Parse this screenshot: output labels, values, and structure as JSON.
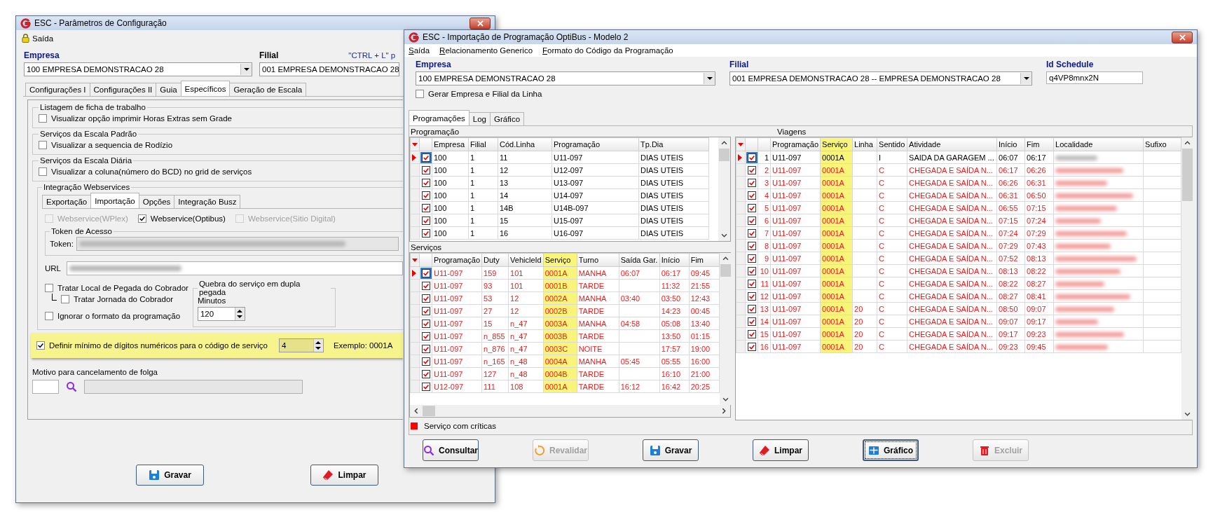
{
  "config_window": {
    "title": "ESC - Parâmetros de Configuração",
    "menu": [
      {
        "label": "Saída"
      }
    ],
    "hint": "\"CTRL + L\" p",
    "empresa": {
      "label": "Empresa",
      "value": "100 EMPRESA DEMONSTRACAO 28"
    },
    "filial": {
      "label": "Filial",
      "value": "001 EMPRESA DEMONSTRACAO 28"
    },
    "tabs": [
      {
        "label": "Configurações I",
        "selected": false
      },
      {
        "label": "Configurações II",
        "selected": false
      },
      {
        "label": "Guia",
        "selected": false
      },
      {
        "label": "Específicos",
        "selected": true
      },
      {
        "label": "Geração de Escala",
        "selected": false
      }
    ],
    "sections": [
      {
        "title": "Listagem de ficha de trabalho",
        "options": [
          {
            "label": "Visualizar opção imprimir Horas Extras sem Grade",
            "checked": false
          }
        ]
      },
      {
        "title": "Serviços da Escala Padrão",
        "options": [
          {
            "label": "Visualizar a sequencia de Rodízio",
            "checked": false
          }
        ]
      },
      {
        "title": "Serviços da Escala Diária",
        "options": [
          {
            "label": "Visualizar a coluna(número do BCD) no grid de serviços",
            "checked": false
          }
        ]
      }
    ],
    "integration": {
      "title": "Integração Webservices",
      "tabs": [
        {
          "label": "Exportação",
          "selected": false
        },
        {
          "label": "Importação",
          "selected": true
        },
        {
          "label": "Opções",
          "selected": false
        },
        {
          "label": "Integração Busz",
          "selected": false
        }
      ],
      "services": [
        {
          "label": "Webservice(WPlex)",
          "checked": false,
          "disabled": true
        },
        {
          "label": "Webservice(Optibus)",
          "checked": true,
          "disabled": false
        },
        {
          "label": "Webservice(Sitio Digital)",
          "checked": false,
          "disabled": true
        }
      ],
      "token_group": "Token de Acesso",
      "token_label": "Token:",
      "url_label": "URL"
    },
    "options": [
      {
        "label": "Tratar Local de Pegada do Cobrador",
        "checked": false,
        "children": [
          {
            "label": "Tratar  Jornada do Cobrador",
            "checked": false
          }
        ]
      },
      {
        "label": "Ignorar o formato da programação",
        "checked": false
      }
    ],
    "split": {
      "title": "Quebra do serviço em dupla pegada",
      "label": "Minutos",
      "value": "120"
    },
    "digits": {
      "label": "Definir mínimo de dígitos numéricos para o código de serviço",
      "checked": true,
      "value": "4",
      "example": "Exemplo: 0001A",
      "highlighted": true
    },
    "motivo": {
      "label": "Motivo para cancelamento de folga"
    },
    "buttons": [
      {
        "label": "Gravar",
        "kind": "save",
        "disabled": false
      },
      {
        "label": "Limpar",
        "kind": "clear",
        "disabled": false
      }
    ]
  },
  "import_window": {
    "title": "ESC - Importação de Programação OptiBus - Modelo 2",
    "menu": [
      {
        "label": "Saída"
      },
      {
        "label": "Relacionamento Generico"
      },
      {
        "label": "Formato do Código da Programação"
      }
    ],
    "empresa": {
      "label": "Empresa",
      "value": "100 EMPRESA DEMONSTRACAO 28"
    },
    "filial": {
      "label": "Filial",
      "value": "001 EMPRESA DEMONSTRACAO 28 -- EMPRESA DEMONSTRACAO 28"
    },
    "schedule": {
      "label": "Id Schedule",
      "value": "q4VP8mnx2N"
    },
    "gerar": {
      "label": "Gerar Empresa e Filial da Linha",
      "checked": false
    },
    "tabs": [
      {
        "label": "Programações",
        "selected": true
      },
      {
        "label": "Log",
        "selected": false
      },
      {
        "label": "Gráfico",
        "selected": false
      }
    ],
    "programacao": {
      "title": "Programação",
      "columns": [
        {
          "label": "Empresa",
          "highlighted": false
        },
        {
          "label": "Filial",
          "highlighted": false
        },
        {
          "label": "Cód.Linha",
          "highlighted": false
        },
        {
          "label": "Programação",
          "highlighted": false
        },
        {
          "label": "Tp.Dia",
          "highlighted": false
        }
      ],
      "rows": [
        {
          "selected": true,
          "checked": true,
          "empresa": "100",
          "filial": "1",
          "cod_linha": "11",
          "programacao": "U11-097",
          "tp_dia": "DIAS UTEIS"
        },
        {
          "selected": false,
          "checked": true,
          "empresa": "100",
          "filial": "1",
          "cod_linha": "12",
          "programacao": "U12-097",
          "tp_dia": "DIAS UTEIS"
        },
        {
          "selected": false,
          "checked": true,
          "empresa": "100",
          "filial": "1",
          "cod_linha": "13",
          "programacao": "U13-097",
          "tp_dia": "DIAS UTEIS"
        },
        {
          "selected": false,
          "checked": true,
          "empresa": "100",
          "filial": "1",
          "cod_linha": "14",
          "programacao": "U14-097",
          "tp_dia": "DIAS UTEIS"
        },
        {
          "selected": false,
          "checked": true,
          "empresa": "100",
          "filial": "1",
          "cod_linha": "14B",
          "programacao": "U14B-097",
          "tp_dia": "DIAS UTEIS"
        },
        {
          "selected": false,
          "checked": true,
          "empresa": "100",
          "filial": "1",
          "cod_linha": "15",
          "programacao": "U15-097",
          "tp_dia": "DIAS UTEIS"
        },
        {
          "selected": false,
          "checked": true,
          "empresa": "100",
          "filial": "1",
          "cod_linha": "16",
          "programacao": "U16-097",
          "tp_dia": "DIAS UTEIS"
        }
      ]
    },
    "servicos": {
      "title": "Serviços",
      "columns": [
        {
          "label": "Programação",
          "highlighted": false
        },
        {
          "label": "Duty",
          "highlighted": false
        },
        {
          "label": "VehicleId",
          "highlighted": false
        },
        {
          "label": "Serviço",
          "highlighted": true
        },
        {
          "label": "Turno",
          "highlighted": false
        },
        {
          "label": "Saída Gar.",
          "highlighted": false
        },
        {
          "label": "Início",
          "highlighted": false
        },
        {
          "label": "Fim",
          "highlighted": false
        }
      ],
      "rows": [
        {
          "selected": true,
          "checked": true,
          "critical": true,
          "programacao": "U11-097",
          "duty": "159",
          "vehicle_id": "101",
          "servico": "0001A",
          "turno": "MANHA",
          "saida_gar": "06:07",
          "inicio": "06:17",
          "fim": "09:45"
        },
        {
          "selected": false,
          "checked": true,
          "critical": true,
          "programacao": "U11-097",
          "duty": "93",
          "vehicle_id": "101",
          "servico": "0001B",
          "turno": "TARDE",
          "inicio": "11:32",
          "fim": "21:55"
        },
        {
          "selected": false,
          "checked": true,
          "critical": true,
          "programacao": "U11-097",
          "duty": "53",
          "vehicle_id": "12",
          "servico": "0002A",
          "turno": "MANHA",
          "saida_gar": "03:40",
          "inicio": "03:50",
          "fim": "12:43"
        },
        {
          "selected": false,
          "checked": true,
          "critical": true,
          "programacao": "U11-097",
          "duty": "27",
          "vehicle_id": "12",
          "servico": "0002B",
          "turno": "TARDE",
          "inicio": "14:23",
          "fim": "00:45"
        },
        {
          "selected": false,
          "checked": true,
          "critical": true,
          "programacao": "U11-097",
          "duty": "15",
          "vehicle_id": "n_47",
          "servico": "0003A",
          "turno": "MANHA",
          "saida_gar": "04:58",
          "inicio": "05:08",
          "fim": "13:40"
        },
        {
          "selected": false,
          "checked": true,
          "critical": true,
          "programacao": "U11-097",
          "duty": "n_855",
          "vehicle_id": "n_47",
          "servico": "0003B",
          "turno": "TARDE",
          "inicio": "13:50",
          "fim": "01:15"
        },
        {
          "selected": false,
          "checked": true,
          "critical": true,
          "programacao": "U11-097",
          "duty": "n_876",
          "vehicle_id": "n_47",
          "servico": "0003C",
          "turno": "NOITE",
          "inicio": "17:57",
          "fim": "19:00"
        },
        {
          "selected": false,
          "checked": true,
          "critical": true,
          "programacao": "U11-097",
          "duty": "n_165",
          "vehicle_id": "n_48",
          "servico": "0004A",
          "turno": "MANHA",
          "saida_gar": "05:45",
          "inicio": "05:55",
          "fim": "16:00"
        },
        {
          "selected": false,
          "checked": true,
          "critical": true,
          "programacao": "U11-097",
          "duty": "127",
          "vehicle_id": "n_48",
          "servico": "0004B",
          "turno": "TARDE",
          "inicio": "16:10",
          "fim": "21:00"
        },
        {
          "selected": false,
          "checked": true,
          "critical": true,
          "programacao": "U12-097",
          "duty": "111",
          "vehicle_id": "108",
          "servico": "0001A",
          "turno": "TARDE",
          "saida_gar": "16:12",
          "inicio": "16:42",
          "fim": "20:25"
        }
      ]
    },
    "viagens": {
      "title": "Viagens",
      "columns": [
        {
          "label": "Programação",
          "highlighted": false
        },
        {
          "label": "Serviço",
          "highlighted": true
        },
        {
          "label": "Linha",
          "highlighted": false
        },
        {
          "label": "Sentido",
          "highlighted": false
        },
        {
          "label": "Atividade",
          "highlighted": false
        },
        {
          "label": "Início",
          "highlighted": false
        },
        {
          "label": "Fim",
          "highlighted": false
        },
        {
          "label": "Localidade",
          "highlighted": false
        },
        {
          "label": "Sufixo",
          "highlighted": false
        }
      ],
      "rows": [
        {
          "selected": true,
          "checked": true,
          "critical": false,
          "num": "1",
          "programacao": "U11-097",
          "servico": "0001A",
          "sentido": "I",
          "atividade": "SAIDA DA GARAGEM ...",
          "inicio": "06:07",
          "fim": "06:17"
        },
        {
          "selected": false,
          "checked": true,
          "critical": true,
          "num": "2",
          "programacao": "U11-097",
          "servico": "0001A",
          "sentido": "C",
          "atividade": "CHEGADA E SAÍDA N...",
          "inicio": "06:17",
          "fim": "06:26"
        },
        {
          "selected": false,
          "checked": true,
          "critical": true,
          "num": "3",
          "programacao": "U11-097",
          "servico": "0001A",
          "sentido": "C",
          "atividade": "CHEGADA E SAÍDA N...",
          "inicio": "06:26",
          "fim": "06:31"
        },
        {
          "selected": false,
          "checked": true,
          "critical": true,
          "num": "4",
          "programacao": "U11-097",
          "servico": "0001A",
          "sentido": "C",
          "atividade": "CHEGADA E SAÍDA N...",
          "inicio": "06:31",
          "fim": "06:50"
        },
        {
          "selected": false,
          "checked": true,
          "critical": true,
          "num": "5",
          "programacao": "U11-097",
          "servico": "0001A",
          "sentido": "C",
          "atividade": "CHEGADA E SAÍDA N...",
          "inicio": "06:55",
          "fim": "07:15"
        },
        {
          "selected": false,
          "checked": true,
          "critical": true,
          "num": "6",
          "programacao": "U11-097",
          "servico": "0001A",
          "sentido": "C",
          "atividade": "CHEGADA E SAÍDA N...",
          "inicio": "07:15",
          "fim": "07:24"
        },
        {
          "selected": false,
          "checked": true,
          "critical": true,
          "num": "7",
          "programacao": "U11-097",
          "servico": "0001A",
          "sentido": "C",
          "atividade": "CHEGADA E SAÍDA N...",
          "inicio": "07:24",
          "fim": "07:29"
        },
        {
          "selected": false,
          "checked": true,
          "critical": true,
          "num": "8",
          "programacao": "U11-097",
          "servico": "0001A",
          "sentido": "C",
          "atividade": "CHEGADA E SAÍDA N...",
          "inicio": "07:29",
          "fim": "07:43"
        },
        {
          "selected": false,
          "checked": true,
          "critical": true,
          "num": "9",
          "programacao": "U11-097",
          "servico": "0001A",
          "sentido": "C",
          "atividade": "CHEGADA E SAÍDA N...",
          "inicio": "07:52",
          "fim": "08:13"
        },
        {
          "selected": false,
          "checked": true,
          "critical": true,
          "num": "10",
          "programacao": "U11-097",
          "servico": "0001A",
          "sentido": "C",
          "atividade": "CHEGADA E SAÍDA N...",
          "inicio": "08:13",
          "fim": "08:22"
        },
        {
          "selected": false,
          "checked": true,
          "critical": true,
          "num": "11",
          "programacao": "U11-097",
          "servico": "0001A",
          "sentido": "C",
          "atividade": "CHEGADA E SAÍDA N...",
          "inicio": "08:22",
          "fim": "08:27"
        },
        {
          "selected": false,
          "checked": true,
          "critical": true,
          "num": "12",
          "programacao": "U11-097",
          "servico": "0001A",
          "sentido": "C",
          "atividade": "CHEGADA E SAÍDA N...",
          "inicio": "08:27",
          "fim": "08:41"
        },
        {
          "selected": false,
          "checked": true,
          "critical": true,
          "num": "13",
          "programacao": "U11-097",
          "servico": "0001A",
          "linha": "20",
          "sentido": "C",
          "atividade": "CHEGADA E SAÍDA N...",
          "inicio": "08:50",
          "fim": "09:07"
        },
        {
          "selected": false,
          "checked": true,
          "critical": true,
          "num": "14",
          "programacao": "U11-097",
          "servico": "0001A",
          "linha": "20",
          "sentido": "C",
          "atividade": "CHEGADA E SAÍDA N...",
          "inicio": "09:07",
          "fim": "09:17"
        },
        {
          "selected": false,
          "checked": true,
          "critical": true,
          "num": "15",
          "programacao": "U11-097",
          "servico": "0001A",
          "linha": "20",
          "sentido": "C",
          "atividade": "CHEGADA E SAÍDA N...",
          "inicio": "09:17",
          "fim": "09:23"
        },
        {
          "selected": false,
          "checked": true,
          "critical": true,
          "num": "16",
          "programacao": "U11-097",
          "servico": "0001A",
          "linha": "20",
          "sentido": "C",
          "atividade": "CHEGADA E SAÍDA N...",
          "inicio": "09:23",
          "fim": "09:45"
        }
      ]
    },
    "legend": {
      "label": "Serviço com críticas",
      "color": "#ff0000"
    },
    "buttons": [
      {
        "label": "Consultar",
        "kind": "search",
        "disabled": false
      },
      {
        "label": "Revalidar",
        "kind": "refresh",
        "disabled": true
      },
      {
        "label": "Gravar",
        "kind": "save",
        "disabled": false
      },
      {
        "label": "Limpar",
        "kind": "clear",
        "disabled": false
      },
      {
        "label": "Gráfico",
        "kind": "chart",
        "disabled": false
      },
      {
        "label": "Excluir",
        "kind": "delete",
        "disabled": true
      }
    ]
  }
}
